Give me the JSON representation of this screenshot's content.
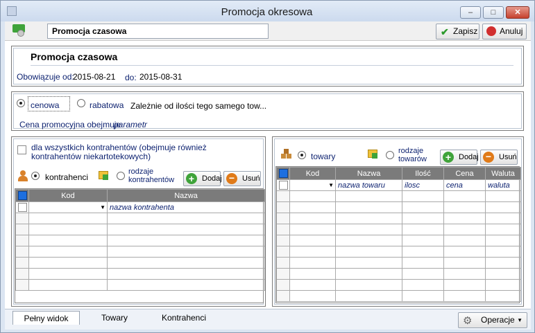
{
  "window": {
    "title": "Promocja okresowa"
  },
  "toolbar": {
    "name_value": "Promocja czasowa",
    "save_label": "Zapisz",
    "cancel_label": "Anuluj"
  },
  "header": {
    "title": "Promocja czasowa",
    "valid_from_label": "Obowiązuje od:",
    "valid_from": "2015-08-21",
    "valid_to_label": "do:",
    "valid_to": "2015-08-31"
  },
  "type": {
    "option_price": "cenowa",
    "option_discount": "rabatowa",
    "qty_dependent": "Zależnie od ilości tego samego tow...",
    "covers_label": "Cena promocyjna obejmuje",
    "covers_value": "parametr"
  },
  "left": {
    "all_contractors": "dla wszystkich kontrahentów (obejmuje również kontrahentów niekartotekowych)",
    "radio_contractors": "kontrahenci",
    "radio_types": "rodzaje kontrahentów",
    "add": "Dodaj",
    "remove": "Usuń",
    "columns": [
      "Kod",
      "Nazwa"
    ],
    "row_placeholder": "nazwa kontrahenta"
  },
  "right": {
    "radio_goods": "towary",
    "radio_types": "rodzaje towarów",
    "add": "Dodaj",
    "remove": "Usuń",
    "columns": [
      "Kod",
      "Nazwa",
      "Ilość",
      "Cena",
      "Waluta"
    ],
    "row": [
      "nazwa towaru",
      "ilosc",
      "cena",
      "waluta"
    ]
  },
  "tabs": [
    "Pełny widok",
    "Towary",
    "Kontrahenci"
  ],
  "operations_label": "Operacje",
  "colors": {
    "accent": "#1d6fe0",
    "header_gray": "#7b7b7b"
  }
}
